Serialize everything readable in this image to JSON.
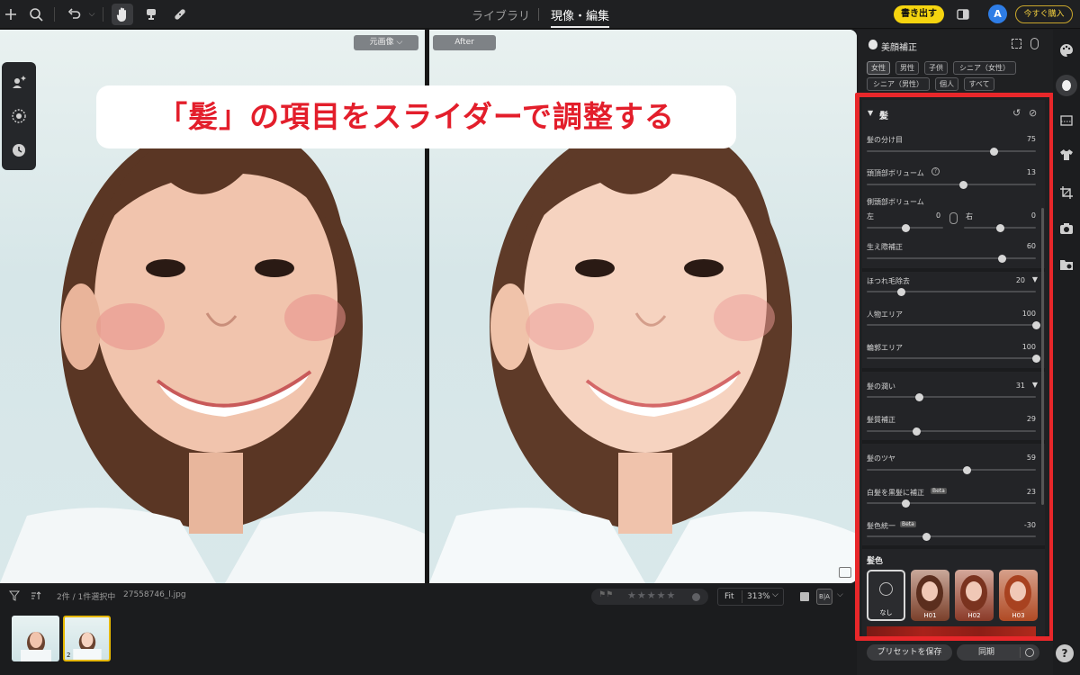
{
  "topbar": {
    "tab_library": "ライブラリ",
    "tab_edit": "現像・編集",
    "export_label": "書き出す",
    "avatar_letter": "A",
    "buy_label": "今すぐ購入"
  },
  "viewer": {
    "original_label": "元画像",
    "after_label": "After",
    "banner_text": "「髪」の項目をスライダーで調整する"
  },
  "bottombar": {
    "count_text": "2件 / 1件選択中",
    "file_name": "27558746_l.jpg",
    "fit_label": "Fit",
    "zoom_value": "313%",
    "thumb_index": "2"
  },
  "panel": {
    "title": "美顔補正",
    "chips_row1": [
      "女性",
      "男性",
      "子供",
      "シニア（女性）"
    ],
    "chips_row2": [
      "シニア（男性）",
      "個人",
      "すべて"
    ],
    "section_title": "髪",
    "sliders": {
      "part": {
        "label": "髪の分け目",
        "value": "75",
        "fill": 0.75
      },
      "crown": {
        "label": "頭頂部ボリューム",
        "value": "13",
        "fill": 0.57
      },
      "side_title": "側頭部ボリューム",
      "side_left_label": "左",
      "side_left_value": "0",
      "side_right_label": "右",
      "side_right_value": "0",
      "hairline": {
        "label": "生え際補正",
        "value": "60",
        "fill": 0.8
      },
      "flyaway": {
        "label": "ほつれ毛除去",
        "value": "20",
        "fill": 0.2
      },
      "person_area": {
        "label": "人物エリア",
        "value": "100",
        "fill": 1.0
      },
      "outline_area": {
        "label": "輪郭エリア",
        "value": "100",
        "fill": 1.0
      },
      "moisture": {
        "label": "髪の潤い",
        "value": "31",
        "fill": 0.31
      },
      "texture": {
        "label": "髪質補正",
        "value": "29",
        "fill": 0.29
      },
      "gloss": {
        "label": "髪のツヤ",
        "value": "59",
        "fill": 0.59
      },
      "gray_to_black": {
        "label": "白髪を黒髪に補正",
        "value": "23",
        "fill": 0.23
      },
      "color_unify": {
        "label": "髪色統一",
        "value": "-30",
        "fill": 0.35
      }
    },
    "beta_label": "Beta",
    "hair_color_title": "髪色",
    "swatches": [
      "なし",
      "H01",
      "H02",
      "H03"
    ],
    "save_preset_label": "プリセットを保存",
    "sync_label": "同期"
  },
  "colors": {
    "accent_yellow": "#f5d40f",
    "highlight_red": "#e8272a",
    "banner_text_red": "#e31e2b"
  }
}
